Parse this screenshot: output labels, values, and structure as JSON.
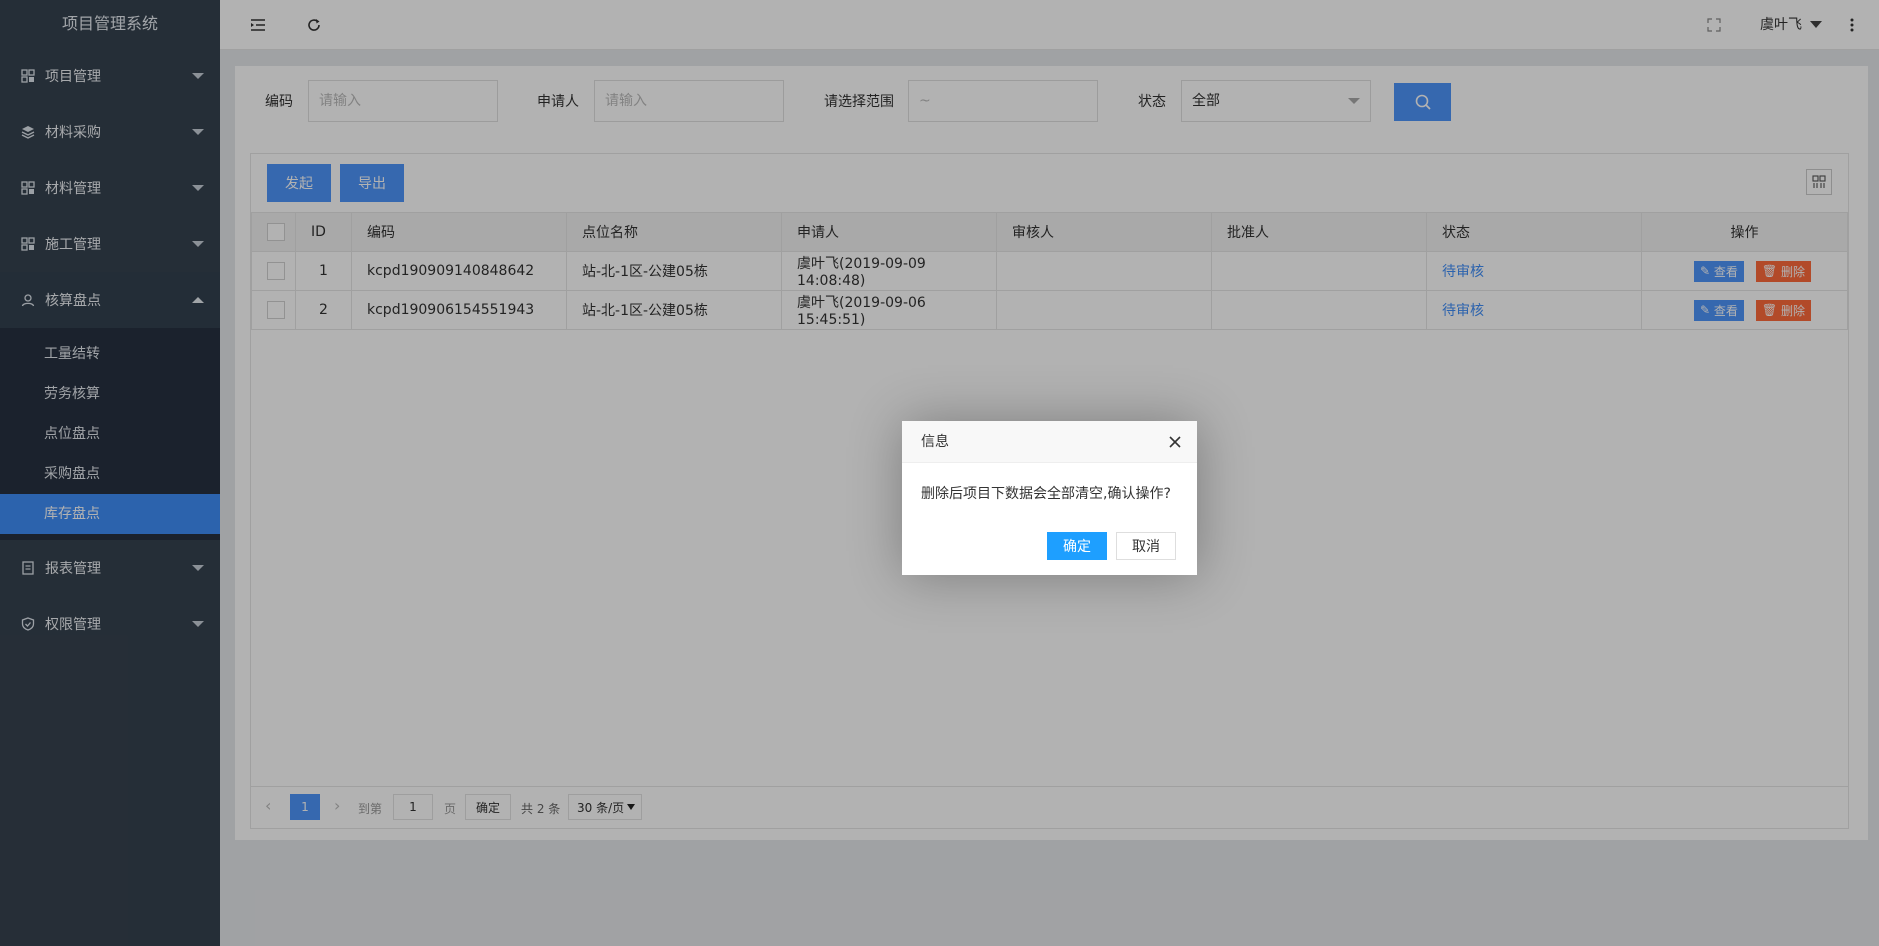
{
  "app": {
    "title": "项目管理系统"
  },
  "sidebar": {
    "items": [
      {
        "label": "项目管理",
        "icon": "grid-icon"
      },
      {
        "label": "材料采购",
        "icon": "layers-icon"
      },
      {
        "label": "材料管理",
        "icon": "grid-icon"
      },
      {
        "label": "施工管理",
        "icon": "grid-icon"
      },
      {
        "label": "核算盘点",
        "icon": "user-icon"
      },
      {
        "label": "报表管理",
        "icon": "document-icon"
      },
      {
        "label": "权限管理",
        "icon": "shield-icon"
      }
    ],
    "submenu": [
      "工量结转",
      "劳务核算",
      "点位盘点",
      "采购盘点",
      "库存盘点"
    ],
    "active_sub": "库存盘点"
  },
  "header": {
    "user": "虞叶飞"
  },
  "filters": {
    "code_label": "编码",
    "code_placeholder": "请输入",
    "applicant_label": "申请人",
    "applicant_placeholder": "请输入",
    "range_label": "请选择范围",
    "range_placeholder": "~",
    "status_label": "状态",
    "status_value": "全部"
  },
  "toolbar": {
    "create_label": "发起",
    "export_label": "导出"
  },
  "table": {
    "headers": [
      "ID",
      "编码",
      "点位名称",
      "申请人",
      "审核人",
      "批准人",
      "状态",
      "操作"
    ],
    "rows": [
      {
        "id": "1",
        "code": "kcpd190909140848642",
        "location": "站-北-1区-公建05栋",
        "applicant": "虞叶飞(2019-09-09 14:08:48)",
        "reviewer": "",
        "approver": "",
        "status": "待审核"
      },
      {
        "id": "2",
        "code": "kcpd190906154551943",
        "location": "站-北-1区-公建05栋",
        "applicant": "虞叶飞(2019-09-06 15:45:51)",
        "reviewer": "",
        "approver": "",
        "status": "待审核"
      }
    ],
    "view_label": "查看",
    "delete_label": "删除"
  },
  "pager": {
    "current_page": "1",
    "goto_label": "到第",
    "goto_value": "1",
    "page_unit": "页",
    "confirm_label": "确定",
    "total_label": "共 2 条",
    "page_size": "30 条/页"
  },
  "dialog": {
    "title": "信息",
    "message": "删除后项目下数据会全部清空,确认操作?",
    "ok_label": "确定",
    "cancel_label": "取消"
  },
  "colors": {
    "sidebar_bg": "#36424f",
    "accent": "#4e95fb",
    "delete": "#ff6a3b",
    "dialog_ok": "#1e9fff"
  }
}
